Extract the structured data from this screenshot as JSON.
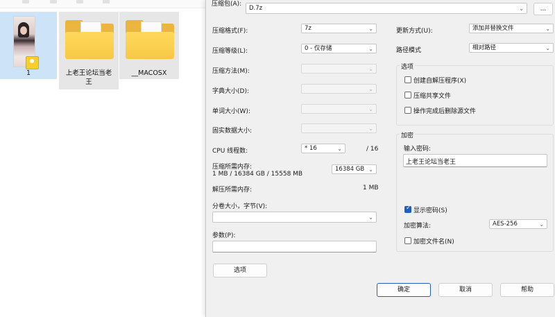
{
  "explorer": {
    "items": [
      {
        "label": "1",
        "kind": "image",
        "selected": true
      },
      {
        "label": "上老王论坛当老王",
        "kind": "folder",
        "selected": true
      },
      {
        "label": "__MACOSX",
        "kind": "folder",
        "selected": true
      }
    ]
  },
  "dialog": {
    "archive_label": "压缩包(A):",
    "archive_path": "D.7z",
    "browse_label": "...",
    "format_label": "压缩格式(F):",
    "format_value": "7z",
    "level_label": "压缩等级(L):",
    "level_value": "0 - 仅存储",
    "method_label": "压缩方法(M):",
    "dict_label": "字典大小(D):",
    "word_label": "单词大小(W):",
    "solid_label": "固实数据大小:",
    "threads_label": "CPU 线程数:",
    "threads_value": "* 16",
    "threads_total": "/ 16",
    "mem_label": "压缩所需内存:",
    "mem_detail": "1 MB / 16384 GB / 15558 MB",
    "mem_value": "16384 GB",
    "decomp_label": "解压所需内存:",
    "decomp_value": "1 MB",
    "split_label": "分卷大小，字节(V):",
    "params_label": "参数(P):",
    "options_button": "选项",
    "update_label": "更新方式(U):",
    "update_value": "添加并替换文件",
    "path_label": "路径模式",
    "path_value": "相对路径",
    "options_group": "选项",
    "opt_sfx": "创建自解压程序(X)",
    "opt_shared": "压缩共享文件",
    "opt_delete": "操作完成后删除源文件",
    "encrypt_group": "加密",
    "password_label": "输入密码:",
    "password_value": "上老王论坛当老王",
    "show_password": "显示密码(S)",
    "enc_method_label": "加密算法:",
    "enc_method_value": "AES-256",
    "enc_names": "加密文件名(N)",
    "ok_button": "确定",
    "cancel_button": "取消",
    "help_button": "帮助"
  },
  "icons": {
    "chevron": "chevron-down-icon",
    "check": "checkmark-icon"
  },
  "colors": {
    "accent": "#1f5fbf",
    "selection": "#cde3f8",
    "folder": "#f6c845"
  }
}
